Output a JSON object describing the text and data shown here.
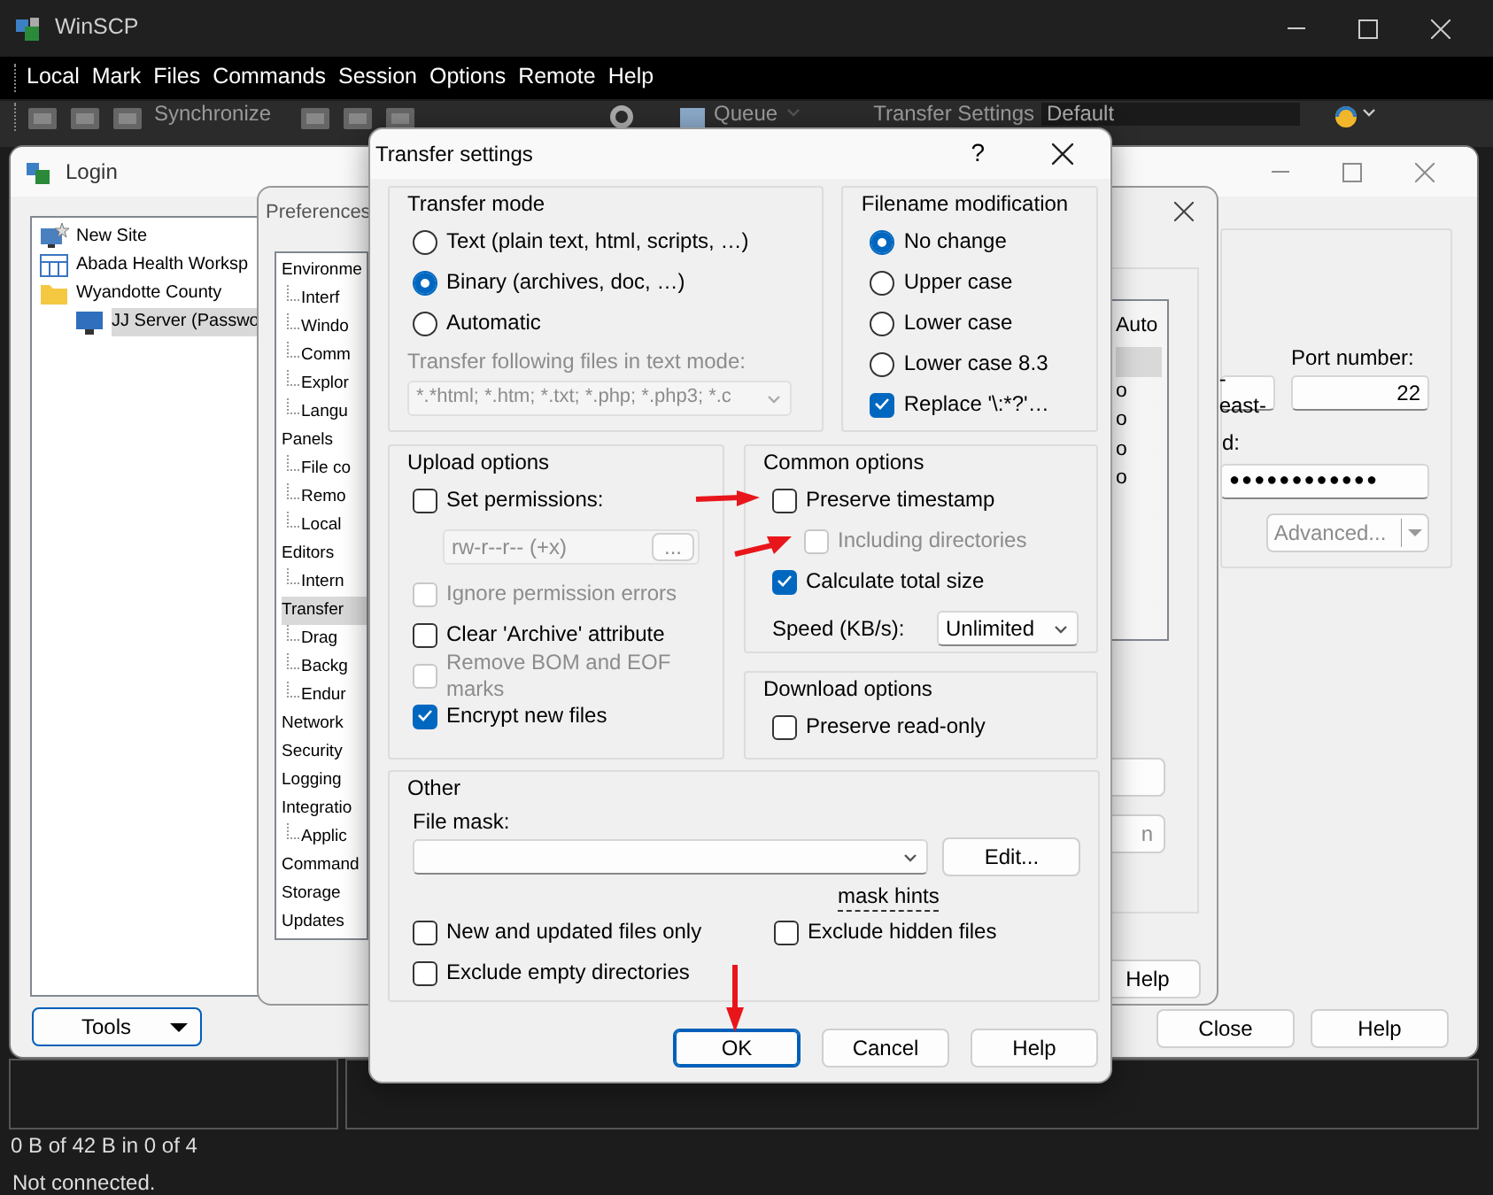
{
  "main_window": {
    "title": "WinSCP",
    "menu": [
      "Local",
      "Mark",
      "Files",
      "Commands",
      "Session",
      "Options",
      "Remote",
      "Help"
    ],
    "toolbar": {
      "synchronize": "Synchronize",
      "queue": "Queue",
      "transfer_settings_label": "Transfer Settings",
      "transfer_preset": "Default"
    },
    "status_bar": {
      "transfer": "0 B of 42 B in 0 of 4",
      "connection": "Not connected."
    }
  },
  "login": {
    "title": "Login",
    "sites": [
      {
        "kind": "new",
        "label": "New Site",
        "selected": false
      },
      {
        "kind": "workspace",
        "label": "Abada Health Worksp",
        "selected": false
      },
      {
        "kind": "folder",
        "label": "Wyandotte County",
        "selected": false,
        "children": [
          {
            "kind": "server",
            "label": "JJ Server (Passwo",
            "selected": true
          }
        ]
      }
    ],
    "tools_button": "Tools",
    "host_fragment": "-east-",
    "port_label": "Port number:",
    "port": "22",
    "password_label_fragment": "d:",
    "password": "●●●●●●●●●●●●",
    "advanced_button": {
      "label": "Advanced...",
      "disabled": true
    },
    "buttons": [
      "Close",
      "Help"
    ]
  },
  "preferences": {
    "title": "Preferences",
    "tree": [
      {
        "label": "Environme",
        "selected": false,
        "children": [
          {
            "label": "Interf",
            "selected": false
          },
          {
            "label": "Windo",
            "selected": false
          },
          {
            "label": "Comm",
            "selected": false
          },
          {
            "label": "Explor",
            "selected": false
          },
          {
            "label": "Langu",
            "selected": false
          }
        ]
      },
      {
        "label": "Panels",
        "selected": false,
        "children": [
          {
            "label": "File co",
            "selected": false
          },
          {
            "label": "Remo",
            "selected": false
          },
          {
            "label": "Local",
            "selected": false
          }
        ]
      },
      {
        "label": "Editors",
        "selected": false,
        "children": [
          {
            "label": "Intern",
            "selected": false
          }
        ]
      },
      {
        "label": "Transfer",
        "selected": true,
        "children": [
          {
            "label": "Drag",
            "selected": false
          },
          {
            "label": "Backg",
            "selected": false
          },
          {
            "label": "Endur",
            "selected": false
          }
        ]
      },
      {
        "label": "Network",
        "selected": false
      },
      {
        "label": "Security",
        "selected": false
      },
      {
        "label": "Logging",
        "selected": false
      },
      {
        "label": "Integratio",
        "selected": false,
        "children": [
          {
            "label": "Applic",
            "selected": false
          }
        ]
      },
      {
        "label": "Command",
        "selected": false
      },
      {
        "label": "Storage",
        "selected": false
      },
      {
        "label": "Updates",
        "selected": false
      }
    ],
    "list_rows": [
      {
        "text": "Auto",
        "selected": false
      },
      {
        "selected": true
      },
      {
        "text": "o",
        "selected": false
      },
      {
        "text": "o",
        "selected": false
      },
      {
        "text": "o",
        "selected": false
      },
      {
        "text": "o",
        "selected": false
      }
    ],
    "side_button_fragment": "n",
    "help_button": "Help"
  },
  "transfer_settings": {
    "title": "Transfer settings",
    "help_glyph": "?",
    "transfer_mode": {
      "title": "Transfer mode",
      "options": [
        {
          "label": "Text (plain text, html, scripts, …)",
          "selected": false
        },
        {
          "label": "Binary (archives, doc, …)",
          "selected": true
        },
        {
          "label": "Automatic",
          "selected": false
        }
      ],
      "text_mode_label": "Transfer following files in text mode:",
      "text_mode_mask": "*.*html; *.htm; *.txt; *.php; *.php3; *.c",
      "text_mode_disabled": true
    },
    "filename_modification": {
      "title": "Filename modification",
      "options": [
        {
          "label": "No change",
          "selected": true
        },
        {
          "label": "Upper case",
          "selected": false
        },
        {
          "label": "Lower case",
          "selected": false
        },
        {
          "label": "Lower case 8.3",
          "selected": false
        }
      ],
      "replace": {
        "label": "Replace '\\:*?'…",
        "checked": true
      }
    },
    "upload_options": {
      "title": "Upload options",
      "items": [
        {
          "kind": "checkbox",
          "label": "Set permissions:",
          "checked": false,
          "disabled": false
        },
        {
          "kind": "permissions",
          "value": "rw-r--r-- (+x)",
          "button": "...",
          "disabled": true
        },
        {
          "kind": "checkbox",
          "label": "Ignore permission errors",
          "checked": false,
          "disabled": true
        },
        {
          "kind": "checkbox",
          "label": "Clear 'Archive' attribute",
          "checked": false,
          "disabled": false
        },
        {
          "kind": "checkbox",
          "label": "Remove BOM and EOF marks",
          "checked": false,
          "disabled": true
        },
        {
          "kind": "checkbox",
          "label": "Encrypt new files",
          "checked": true,
          "disabled": false
        }
      ]
    },
    "common_options": {
      "title": "Common options",
      "items": [
        {
          "kind": "checkbox",
          "label": "Preserve timestamp",
          "checked": false,
          "disabled": false
        },
        {
          "kind": "subcheckbox",
          "label": "Including directories",
          "checked": false,
          "disabled": true
        },
        {
          "kind": "checkbox",
          "label": "Calculate total size",
          "checked": true,
          "disabled": false
        },
        {
          "kind": "select",
          "label": "Speed (KB/s):",
          "value": "Unlimited"
        }
      ]
    },
    "download_options": {
      "title": "Download options",
      "items": [
        {
          "kind": "checkbox",
          "label": "Preserve read-only",
          "checked": false,
          "disabled": false
        }
      ]
    },
    "other": {
      "title": "Other",
      "file_mask_label": "File mask:",
      "edit_button": "Edit...",
      "mask_hints_link": "mask hints",
      "items": [
        {
          "label": "New and updated files only",
          "checked": false
        },
        {
          "label": "Exclude hidden files",
          "checked": false
        },
        {
          "label": "Exclude empty directories",
          "checked": false
        }
      ]
    },
    "buttons": [
      {
        "label": "OK",
        "default": true
      },
      {
        "label": "Cancel",
        "default": false
      },
      {
        "label": "Help",
        "default": false
      }
    ]
  }
}
